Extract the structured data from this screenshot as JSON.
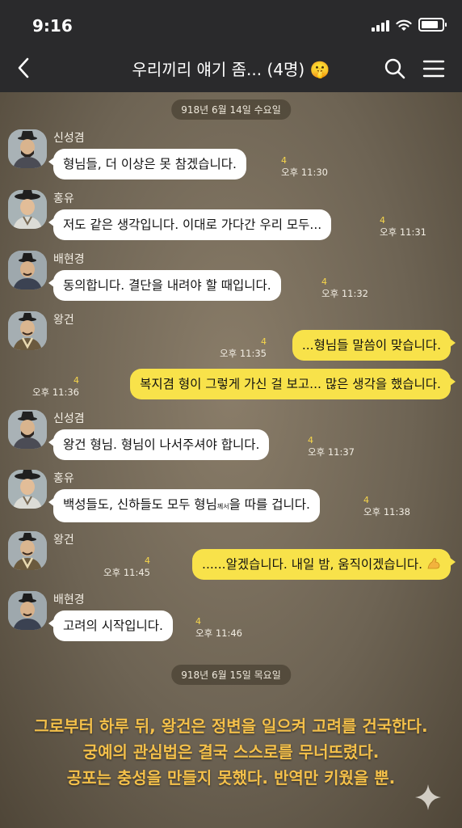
{
  "status_bar": {
    "time": "9:16"
  },
  "header": {
    "title": "우리끼리 얘기 좀... (4명) 🤫"
  },
  "colors": {
    "my_bubble": "#f8e24a",
    "other_bubble": "#ffffff",
    "caption": "#f4c04a",
    "header_bg": "#2a2a2c"
  },
  "dates": [
    "918년 6월 14일 수요일",
    "918년 6월 15일 목요일"
  ],
  "messages": [
    {
      "sender": "신성겸",
      "text": "형님들, 더 이상은 못 참겠습니다.",
      "count": "4",
      "time": "오후 11:30"
    },
    {
      "sender": "홍유",
      "text": "저도 같은 생각입니다. 이대로 가다간 우리 모두...",
      "count": "4",
      "time": "오후 11:31"
    },
    {
      "sender": "배현경",
      "text": "동의합니다. 결단을 내려야 할 때입니다.",
      "count": "4",
      "time": "오후 11:32"
    },
    {
      "sender": "왕건",
      "text": "...형님들 말씀이 맞습니다.",
      "count": "4",
      "time": "오후 11:35"
    },
    {
      "text": "복지겸 형이 그렇게 가신 걸 보고... 많은 생각을 했습니다.",
      "count": "4",
      "time": "오후 11:36"
    },
    {
      "sender": "신성겸",
      "text": "왕건 형님. 형님이 나서주셔야 합니다.",
      "count": "4",
      "time": "오후 11:37"
    },
    {
      "sender": "홍유",
      "text": "백성들도, 신하들도 모두 형님",
      "text_small": "께서",
      "text_end": "을 따를 겁니다.",
      "count": "4",
      "time": "오후 11:38"
    },
    {
      "sender": "왕건",
      "text": "......알겠습니다. 내일 밤, 움직이겠습니다.",
      "count": "4",
      "time": "오후 11:45"
    },
    {
      "sender": "배현경",
      "text": "고려의 시작입니다.",
      "count": "4",
      "time": "오후 11:46"
    }
  ],
  "caption": [
    "그로부터 하루 뒤, 왕건은 정변을 일으켜 고려를 건국한다.",
    "궁예의 관심법은 결국 스스로를 무너뜨렸다.",
    "공포는 충성을 만들지 못했다. 반역만 키웠을 뿐."
  ],
  "icons": {
    "back": "chevron-left-icon",
    "search": "search-icon",
    "menu": "hamburger-menu-icon",
    "sparkle": "sparkle-icon",
    "emoji": "flexed-biceps-icon"
  }
}
